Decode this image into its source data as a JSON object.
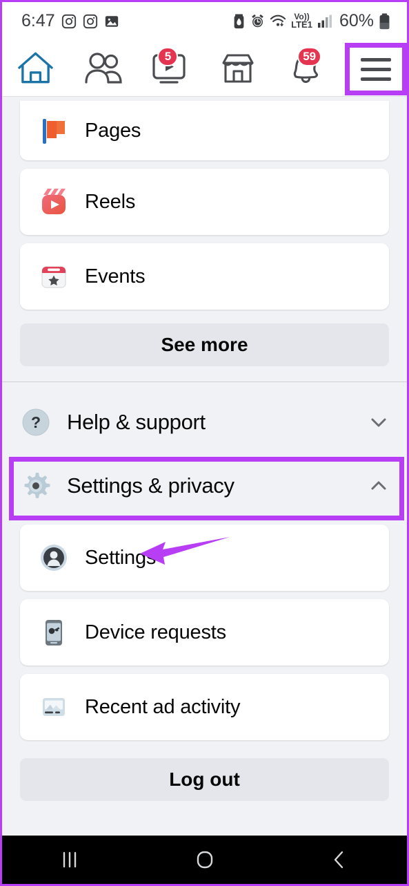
{
  "status_bar": {
    "time": "6:47",
    "battery_percent": "60%",
    "network": "LTE1",
    "volte": "Vo))",
    "icons": [
      "instagram-icon",
      "instagram-icon",
      "gallery-icon",
      "battery-saver-icon",
      "alarm-icon",
      "wifi-icon",
      "volte-icon",
      "signal-icon",
      "battery-icon"
    ]
  },
  "top_nav": {
    "items": [
      {
        "name": "home",
        "icon": "home-icon",
        "active": true,
        "badge": ""
      },
      {
        "name": "friends",
        "icon": "friends-icon",
        "active": false,
        "badge": ""
      },
      {
        "name": "video",
        "icon": "video-icon",
        "active": false,
        "badge": "5"
      },
      {
        "name": "marketplace",
        "icon": "marketplace-icon",
        "active": false,
        "badge": ""
      },
      {
        "name": "notifications",
        "icon": "bell-icon",
        "active": false,
        "badge": "59"
      },
      {
        "name": "menu",
        "icon": "hamburger-icon",
        "active": false,
        "badge": ""
      }
    ],
    "active_color": "#1b74a8"
  },
  "shortcuts": {
    "items": [
      {
        "label": "Pages",
        "icon": "pages-flag-icon"
      },
      {
        "label": "Reels",
        "icon": "reels-clapper-icon"
      },
      {
        "label": "Events",
        "icon": "events-calendar-icon"
      }
    ],
    "see_more_label": "See more"
  },
  "expandables": [
    {
      "label": "Help & support",
      "icon": "help-question-icon",
      "expanded": false,
      "chevron": "chevron-down-icon"
    },
    {
      "label": "Settings & privacy",
      "icon": "gear-icon",
      "expanded": true,
      "chevron": "chevron-up-icon"
    }
  ],
  "settings_items": [
    {
      "label": "Settings",
      "icon": "person-circle-icon"
    },
    {
      "label": "Device requests",
      "icon": "phone-key-icon"
    },
    {
      "label": "Recent ad activity",
      "icon": "ad-activity-icon"
    }
  ],
  "log_out_label": "Log out",
  "annotations": {
    "highlight_color": "#b83ef5",
    "boxes": [
      "menu-highlight",
      "settings-privacy-highlight"
    ],
    "arrow": "arrow-pointing-to-settings"
  },
  "system_nav": {
    "recents": "recents-icon",
    "home": "home-circle-icon",
    "back": "back-chevron-icon"
  }
}
